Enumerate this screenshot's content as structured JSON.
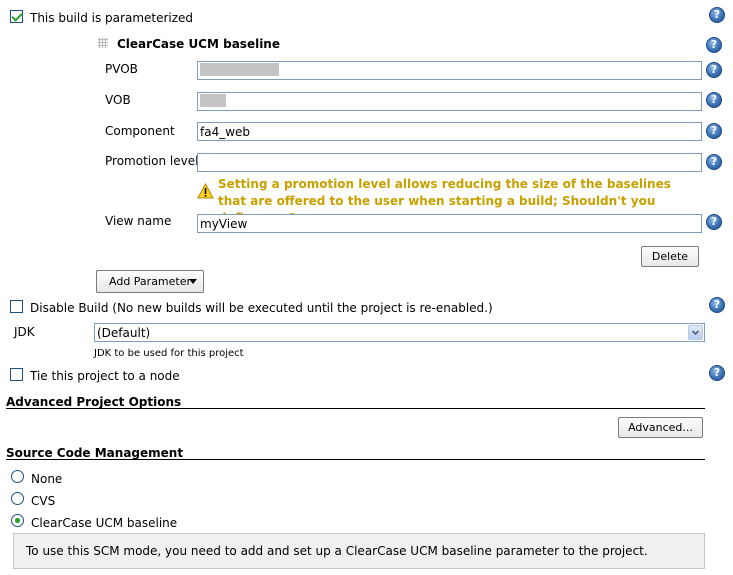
{
  "parameterized": {
    "label": "This build is parameterized",
    "checked": true
  },
  "parameter": {
    "title": "ClearCase UCM baseline",
    "fields": {
      "pvob": {
        "label": "PVOB",
        "value": ""
      },
      "vob": {
        "label": "VOB",
        "value": ""
      },
      "component": {
        "label": "Component",
        "value": "fa4_web"
      },
      "promotion": {
        "label": "Promotion level",
        "value": ""
      },
      "view": {
        "label": "View name",
        "value": "myView"
      }
    },
    "warning": "Setting a promotion level allows reducing the size of the baselines that are offered to the user when starting a build; Shouldn't you define one?",
    "delete_label": "Delete"
  },
  "add_parameter_label": "Add Parameter",
  "disable_build": {
    "label": "Disable Build (No new builds will be executed until the project is re-enabled.)",
    "checked": false
  },
  "jdk": {
    "label": "JDK",
    "selected": "(Default)",
    "hint": "JDK to be used for this project"
  },
  "tie_node": {
    "label": "Tie this project to a node",
    "checked": false
  },
  "advanced_options": {
    "title": "Advanced Project Options",
    "button_label": "Advanced..."
  },
  "scm": {
    "title": "Source Code Management",
    "options": [
      {
        "label": "None",
        "selected": false
      },
      {
        "label": "CVS",
        "selected": false
      },
      {
        "label": "ClearCase UCM baseline",
        "selected": true
      }
    ],
    "info": "To use this SCM mode, you need to add and set up a ClearCase UCM baseline parameter to the project."
  },
  "help_icon_glyph": "?",
  "colors": {
    "warning_text": "#c8a000",
    "field_border": "#7f9db9",
    "info_box_bg": "#f0f0f0"
  }
}
